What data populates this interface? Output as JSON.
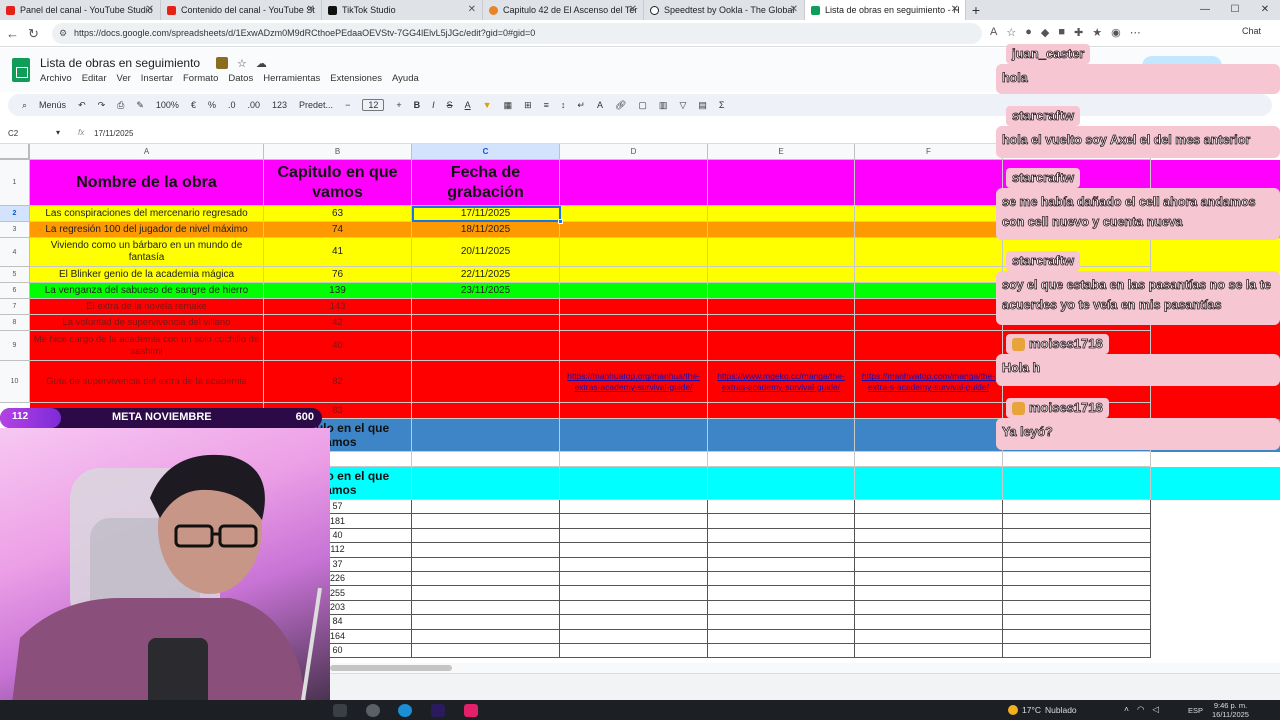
{
  "browser": {
    "tabs": [
      {
        "title": "Panel del canal - YouTube Studio",
        "color": "#e62117",
        "active": false
      },
      {
        "title": "Contenido del canal - YouTube St",
        "color": "#e62117",
        "active": false
      },
      {
        "title": "TikTok Studio",
        "color": "#111111",
        "active": false
      },
      {
        "title": "Capitulo 42 de El Ascenso del Ter",
        "color": "#e8832a",
        "active": false
      },
      {
        "title": "Speedtest by Ookla - The Global",
        "color": "#222222",
        "active": false
      },
      {
        "title": "Lista de obras en seguimiento - H",
        "color": "#0f9d58",
        "active": true
      }
    ],
    "url": "https://docs.google.com/spreadsheets/d/1ExwADzm0M9dRCthoePEdaaOEVStv-7GG4lElvL5jJGc/edit?gid=0#gid=0",
    "chat_button_label": "Chat"
  },
  "sheets": {
    "doc_title": "Lista de obras en seguimiento",
    "menu": [
      "Archivo",
      "Editar",
      "Ver",
      "Insertar",
      "Formato",
      "Datos",
      "Herramientas",
      "Extensiones",
      "Ayuda"
    ],
    "toolbar": {
      "menus_label": "Menús",
      "zoom": "100%",
      "currency": "€",
      "percent": "%",
      "dec_decrease": ".0",
      "dec_increase": ".00",
      "number_format": "123",
      "font": "Predet...",
      "font_size": "12",
      "bold": "B",
      "italic": "I",
      "strike": "S",
      "text_color": "A",
      "sum": "Σ"
    },
    "name_box": "C2",
    "fx_label": "fx",
    "formula_value": "17/11/2025",
    "columns": [
      "A",
      "B",
      "C",
      "D",
      "E",
      "F"
    ],
    "rows": [
      "1",
      "2",
      "3",
      "4",
      "5",
      "6",
      "7",
      "8",
      "9",
      "10"
    ],
    "header": {
      "a": "Nombre de la obra",
      "b": "Capitulo en que vamos",
      "c": "Fecha de grabación"
    },
    "data_rows": [
      {
        "name": "Las conspiraciones del mercenario regresado",
        "chapter": "63",
        "date": "17/11/2025"
      },
      {
        "name": "La regresión 100 del jugador de nivel máximo",
        "chapter": "74",
        "date": "18/11/2025"
      },
      {
        "name": "Viviendo como un bárbaro en un mundo de fantasía",
        "chapter": "41",
        "date": "20/11/2025"
      },
      {
        "name": "El Blinker genio de la academia mágica",
        "chapter": "76",
        "date": "22/11/2025"
      },
      {
        "name": "La venganza del sabueso de sangre de hierro",
        "chapter": "139",
        "date": "23/11/2025"
      },
      {
        "name": "El extra de la novela remake",
        "chapter": "143",
        "date": ""
      },
      {
        "name": "La voluntad de supervivencia del villano",
        "chapter": "42",
        "date": ""
      },
      {
        "name": "Me hice cargo de la academia con un solo cuchillo de sashimi",
        "chapter": "40",
        "date": ""
      },
      {
        "name": "Guía de supervivencia del extra de la academia",
        "chapter": "82",
        "date": ""
      },
      {
        "name": "",
        "chapter": "83",
        "date": ""
      }
    ],
    "links": [
      "https://manhuatop.org/manhua/the-extras-academy-survival-guide/",
      "https://www.mgeko.cc/manga/the-extras-academy-survival-guide/",
      "https://manhwatop.com/manga/the-extra-s-academy-survival-guide/"
    ],
    "section2_label": "Capitulo en el que vamos",
    "section3_label": "Capitulo en el que vamos",
    "chapter_list": [
      "57",
      "181",
      "40",
      "112",
      "37",
      "226",
      "255",
      "203",
      "84",
      "164",
      "60"
    ],
    "colors": {
      "header": "#ff00ff",
      "yellow": "#ffff00",
      "orange": "#ff9900",
      "green": "#00ff00",
      "red": "#ff0000",
      "blue": "#3d85c6",
      "cyan": "#00ffff"
    }
  },
  "overlay": {
    "goal_current": "112",
    "goal_label": "META NOVIEMBRE",
    "goal_target": "600",
    "goal_fraction": 0.19
  },
  "chat": [
    {
      "user": "juan_caster",
      "message": "hola",
      "crown": false
    },
    {
      "user": "starcraftw",
      "message": "hola el vuelto soy Axel el del mes anterior",
      "crown": false
    },
    {
      "user": "starcraftw",
      "message": "se me había dañado el cell ahora andamos con cell nuevo y cuenta nueva",
      "crown": false
    },
    {
      "user": "starcraftw",
      "message": "soy el que estaba en las pasantías no se la te acuerdes yo te veía en mis pasantías",
      "crown": false
    },
    {
      "user": "moises1718",
      "message": "Hola h",
      "crown": true
    },
    {
      "user": "moises1718",
      "message": "Ya leyó?",
      "crown": true
    }
  ],
  "taskbar": {
    "temperature": "17°C",
    "weather": "Nublado",
    "language": "ESP",
    "time": "9:46 p. m.",
    "date": "16/11/2025"
  }
}
